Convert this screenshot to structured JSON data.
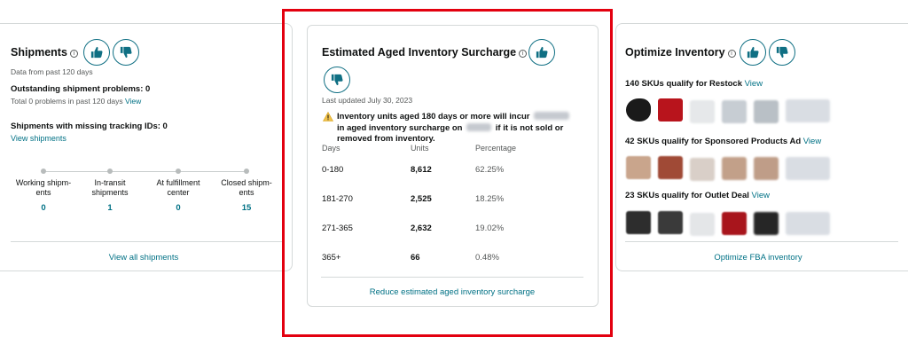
{
  "shipments": {
    "title": "Shipments",
    "subtitle": "Data from past 120 days",
    "outstanding_label": "Outstanding shipment problems: 0",
    "outstanding_sub": "Total 0 problems in past 120 days",
    "view_link": "View",
    "missing_label": "Shipments with missing tracking IDs: 0",
    "view_shipments_link": "View shipments",
    "stages": [
      {
        "label": "Working shipm-ents",
        "count": "0"
      },
      {
        "label": "In-transit shipments",
        "count": "1"
      },
      {
        "label": "At fulfillment center",
        "count": "0"
      },
      {
        "label": "Closed shipm-ents",
        "count": "15"
      }
    ],
    "footer_link": "View all shipments"
  },
  "aged_inventory": {
    "title": "Estimated Aged Inventory Surcharge",
    "last_updated": "Last updated July 30, 2023",
    "warning_part1": "Inventory units aged 180 days or more will incur",
    "warning_part2": "in aged inventory surcharge on",
    "warning_part3": "if it is not sold or removed from inventory.",
    "columns": [
      "Days",
      "Units",
      "Percentage"
    ],
    "rows": [
      {
        "days": "0-180",
        "units": "8,612",
        "pct": "62.25%"
      },
      {
        "days": "181-270",
        "units": "2,525",
        "pct": "18.25%"
      },
      {
        "days": "271-365",
        "units": "2,632",
        "pct": "19.02%"
      },
      {
        "days": "365+",
        "units": "66",
        "pct": "0.48%"
      }
    ],
    "footer_link": "Reduce estimated aged inventory surcharge"
  },
  "optimize": {
    "title": "Optimize Inventory",
    "restock_label": "140 SKUs qualify for Restock",
    "sponsored_label": "42 SKUs qualify for Sponsored Products Ad",
    "outlet_label": "23 SKUs qualify for Outlet Deal",
    "view_link": "View",
    "footer_link": "Optimize FBA inventory"
  },
  "colors": {
    "accent": "#007185",
    "highlight": "#e3000f",
    "warning": "#f0c14b"
  },
  "icons": [
    "thumbs-up-icon",
    "thumbs-down-icon",
    "info-icon",
    "warning-icon"
  ]
}
